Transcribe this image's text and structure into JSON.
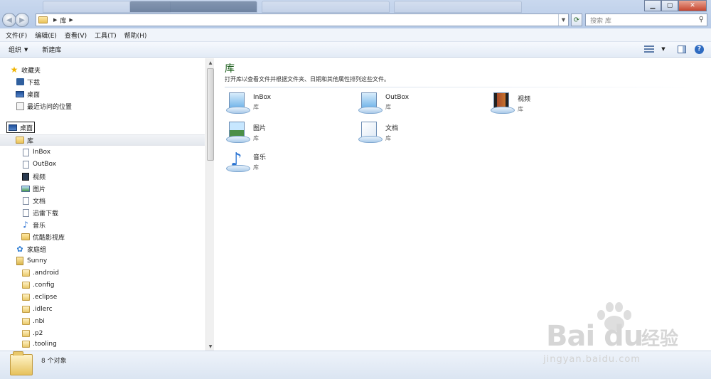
{
  "window": {
    "minimize": "▁",
    "maximize": "▢",
    "close": "✕"
  },
  "address": {
    "breadcrumb": [
      "库"
    ],
    "search_placeholder": "搜索 库"
  },
  "menu": [
    "文件(F)",
    "编辑(E)",
    "查看(V)",
    "工具(T)",
    "帮助(H)"
  ],
  "toolbar": {
    "organize": "组织",
    "new_library": "新建库",
    "help": "?"
  },
  "nav": {
    "favorites": {
      "label": "收藏夹",
      "items": [
        "下载",
        "桌面",
        "最近访问的位置"
      ]
    },
    "desktop": "桌面",
    "library": {
      "label": "库",
      "items": [
        "InBox",
        "OutBox",
        "视频",
        "图片",
        "文档",
        "迅雷下载",
        "音乐",
        "优酷影视库"
      ]
    },
    "homegroup": "家庭组",
    "user": {
      "label": "Sunny",
      "items": [
        ".android",
        ".config",
        ".eclipse",
        ".idlerc",
        ".nbi",
        ".p2",
        ".tooling"
      ]
    }
  },
  "main": {
    "title": "库",
    "description": "打开库以查看文件并根据文件夹、日期和其他属性排列这些文件。",
    "libraries": [
      {
        "name": "InBox",
        "type": "库",
        "icon": "library-doc-icon"
      },
      {
        "name": "OutBox",
        "type": "库",
        "icon": "library-doc-icon"
      },
      {
        "name": "视频",
        "type": "库",
        "icon": "library-video-icon"
      },
      {
        "name": "图片",
        "type": "库",
        "icon": "library-picture-icon"
      },
      {
        "name": "文档",
        "type": "库",
        "icon": "library-document-icon"
      },
      {
        "name": "音乐",
        "type": "库",
        "icon": "library-music-icon"
      }
    ]
  },
  "status": {
    "count": "8 个对象"
  },
  "watermark": {
    "brand": "Bai du",
    "cn": "经验",
    "url": "jingyan.baidu.com"
  }
}
